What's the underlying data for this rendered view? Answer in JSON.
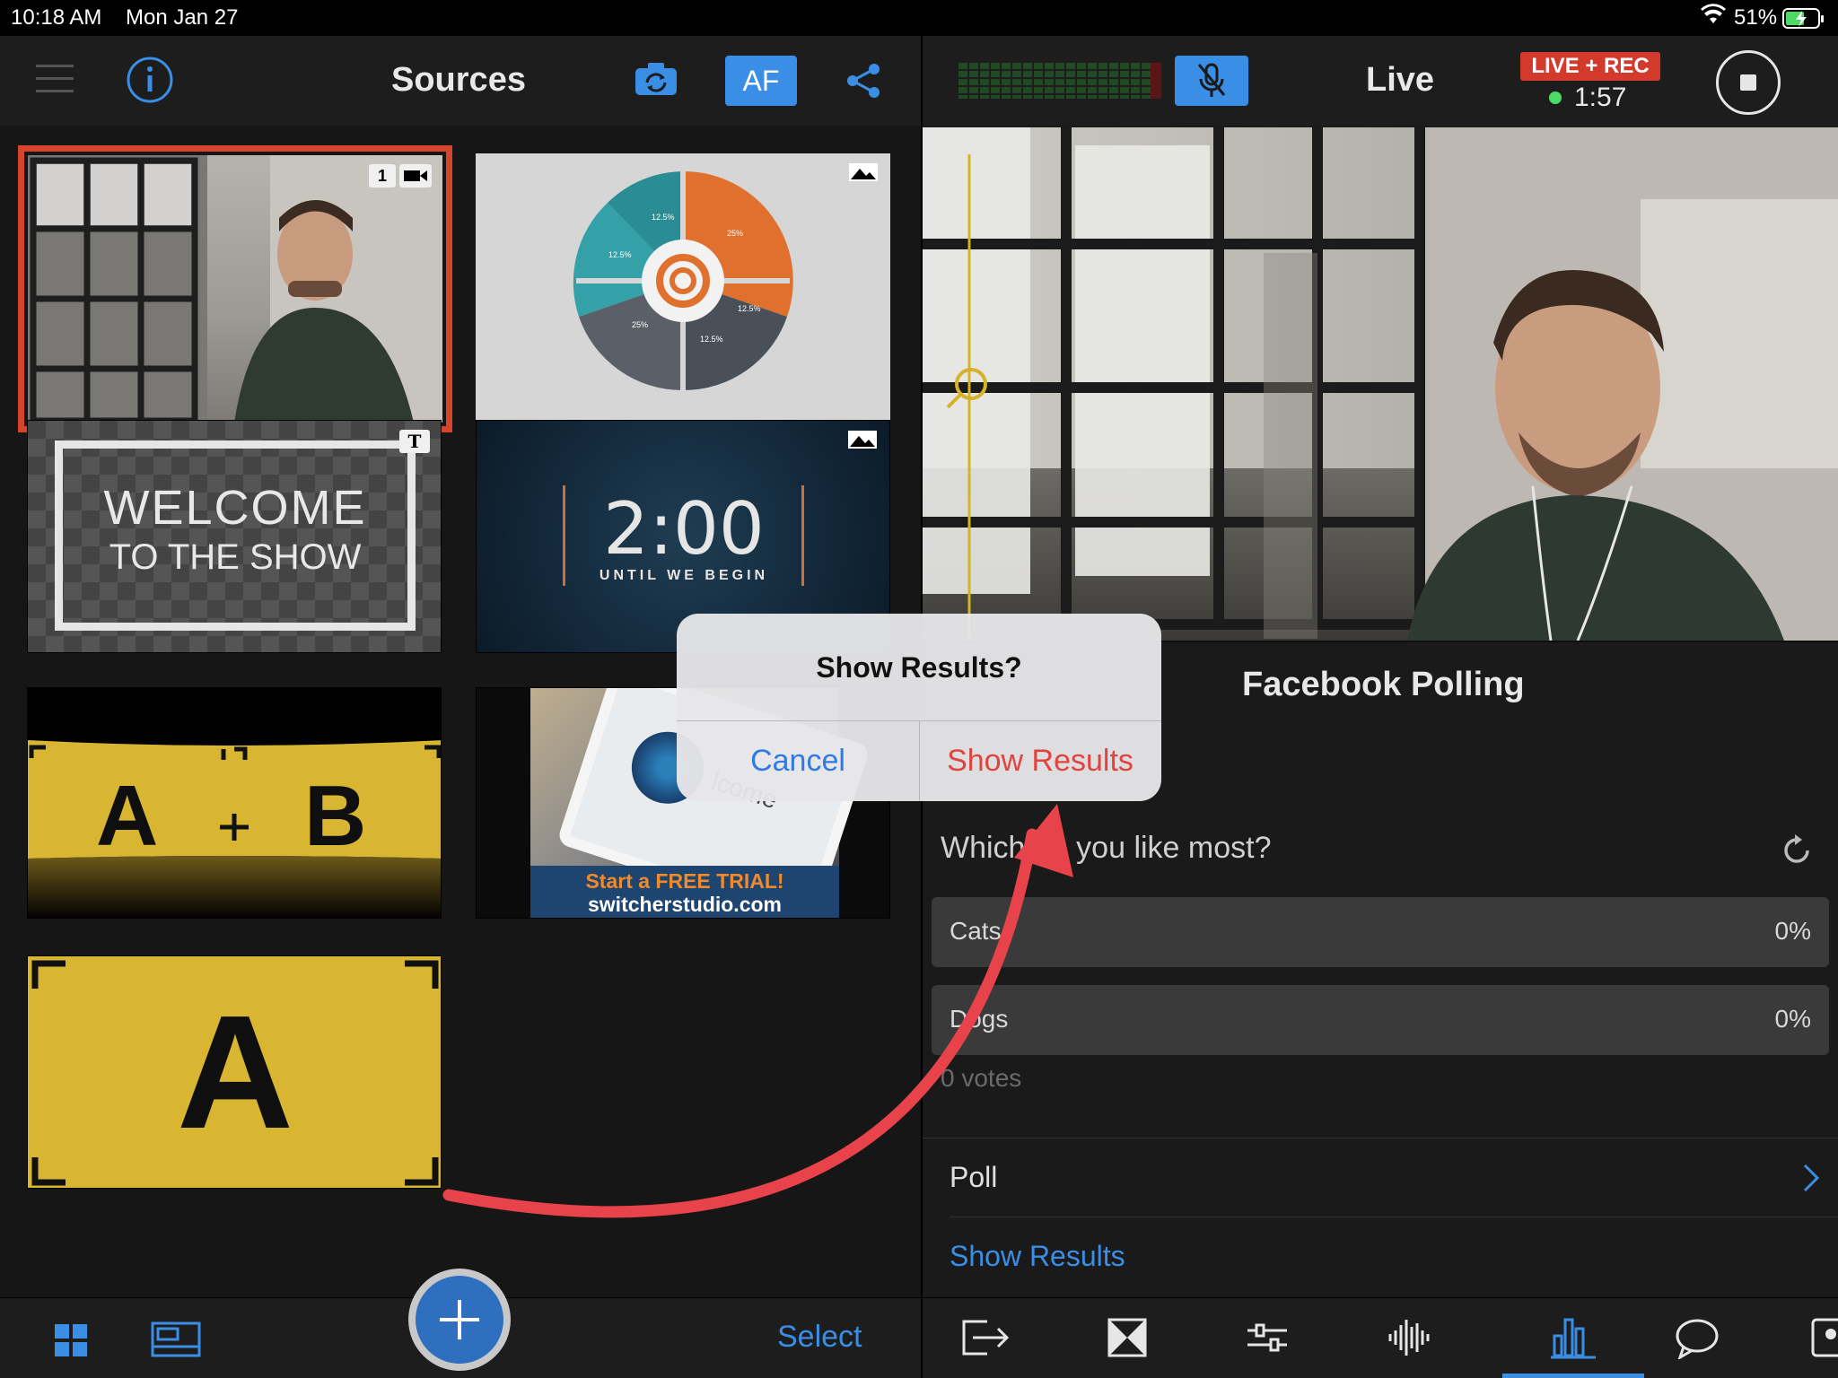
{
  "status_bar": {
    "time": "10:18 AM",
    "date": "Mon Jan 27",
    "battery": "51%"
  },
  "sources_panel": {
    "title": "Sources",
    "af_label": "AF",
    "tiles": {
      "camera_badge": "1",
      "welcome_line1": "WELCOME",
      "welcome_line2": "TO THE SHOW",
      "countdown_time": "2:00",
      "countdown_sub": "UNTIL WE BEGIN",
      "pie_labels": [
        "12.5%",
        "25%",
        "12.5%",
        "12.5%",
        "25%",
        "12.5%"
      ],
      "ab_left": "A",
      "ab_right": "B",
      "promo_text": "Start a FREE TRIAL!",
      "promo_url": "switcherstudio.com",
      "promo_screen_text": "lcome",
      "big_a": "A"
    },
    "bottom": {
      "select_label": "Select"
    }
  },
  "live_panel": {
    "title": "Live",
    "status_badge": "LIVE + REC",
    "timer": "1:57",
    "section_title": "Facebook Polling",
    "poll_question": "Which do you like most?",
    "options": [
      {
        "label": "Cats",
        "percent": "0%",
        "fraction": 0
      },
      {
        "label": "Dogs",
        "percent": "0%",
        "fraction": 0
      }
    ],
    "votes_text": "0 votes",
    "poll_row_label": "Poll",
    "show_results_link": "Show Results"
  },
  "dialog": {
    "title": "Show Results?",
    "cancel_label": "Cancel",
    "confirm_label": "Show Results"
  },
  "colors": {
    "accent_blue": "#3a8ee6",
    "live_red": "#d33a2c",
    "highlight_red": "#e8434a",
    "tile_yellow": "#d9b632",
    "dialog_red": "#e0443e"
  }
}
